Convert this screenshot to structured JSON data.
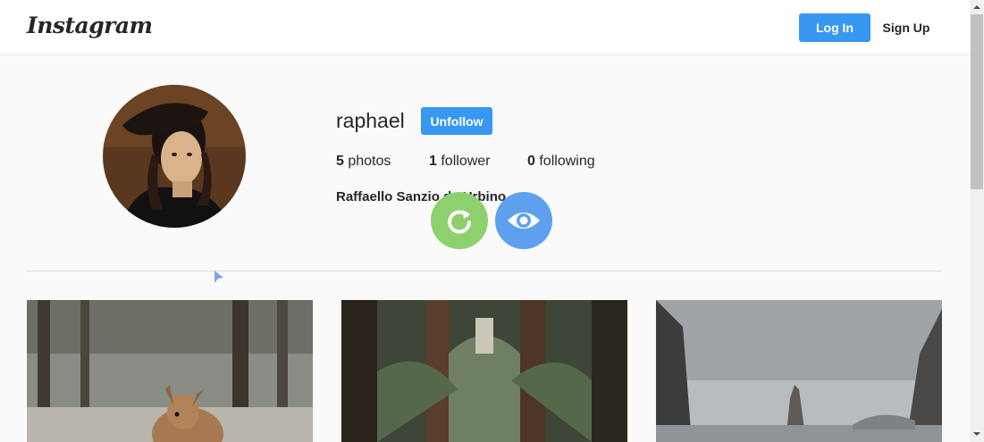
{
  "header": {
    "logo_text": "Instagram",
    "login_label": "Log In",
    "signup_label": "Sign Up"
  },
  "profile": {
    "username": "raphael",
    "action_label": "Unfollow",
    "stats": [
      {
        "count": "5",
        "label": "photos"
      },
      {
        "count": "1",
        "label": "follower"
      },
      {
        "count": "0",
        "label": "following"
      }
    ],
    "full_name": "Raffaello Sanzio da Urbino"
  },
  "overlay_buttons": [
    {
      "icon": "refresh-icon",
      "color": "#8ed06e"
    },
    {
      "icon": "eye-icon",
      "color": "#5ea0ee"
    }
  ],
  "colors": {
    "accent": "#3897f0",
    "background": "#fafafa"
  },
  "photos": [
    {
      "subject": "deer-in-forest"
    },
    {
      "subject": "fern-forest-path"
    },
    {
      "subject": "sea-rock-spire"
    }
  ]
}
